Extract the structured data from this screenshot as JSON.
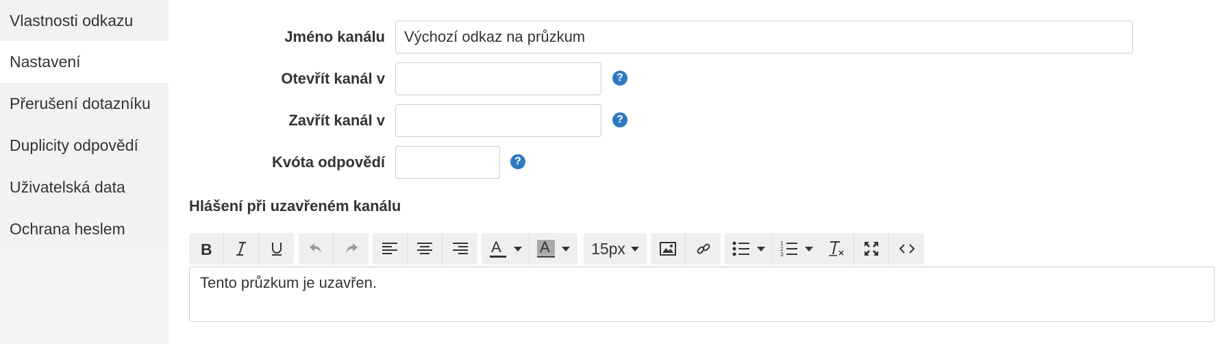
{
  "sidebar": {
    "items": [
      {
        "label": "Vlastnosti odkazu"
      },
      {
        "label": "Nastavení"
      },
      {
        "label": "Přerušení dotazníku"
      },
      {
        "label": "Duplicity odpovědí"
      },
      {
        "label": "Uživatelská data"
      },
      {
        "label": "Ochrana heslem"
      }
    ],
    "active": "Nastavení"
  },
  "form": {
    "channel_name": {
      "label": "Jméno kanálu",
      "value": "Výchozí odkaz na průzkum"
    },
    "open_channel": {
      "label": "Otevřít kanál v",
      "value": ""
    },
    "close_channel": {
      "label": "Zavřít kanál v",
      "value": ""
    },
    "quota": {
      "label": "Kvóta odpovědí",
      "value": ""
    },
    "help_glyph": "?"
  },
  "message_section": {
    "title": "Hlášení při uzavřeném kanálu"
  },
  "toolbar": {
    "font_size": "15px",
    "buttons": [
      "bold-icon",
      "italic-icon",
      "underline-icon",
      "undo-icon",
      "redo-icon",
      "align-left-icon",
      "align-center-icon",
      "align-right-icon",
      "font-color-icon",
      "highlight-color-icon",
      "font-size-dropdown",
      "image-icon",
      "link-icon",
      "bullet-list-icon",
      "numbered-list-icon",
      "clear-format-icon",
      "fullscreen-icon",
      "code-view-icon"
    ],
    "colors": {
      "highlight": "#a9a9a9",
      "help": "#2e7ac0"
    }
  },
  "editor": {
    "content": "Tento průzkum je uzavřen."
  }
}
